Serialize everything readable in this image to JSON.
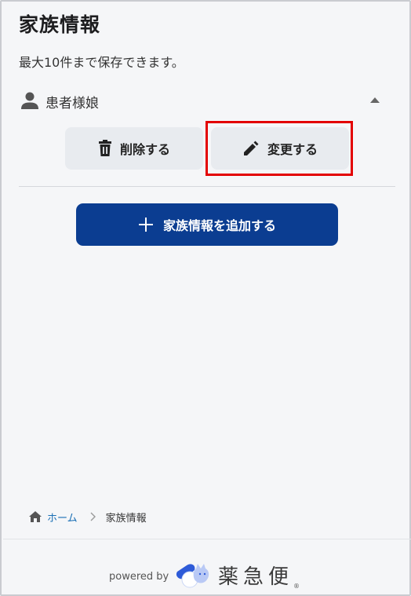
{
  "page": {
    "title": "家族情報",
    "subtitle": "最大10件まで保存できます。"
  },
  "member": {
    "name": "患者様娘",
    "icon": "person-icon",
    "toggle_icon": "caret-up-icon"
  },
  "actions": {
    "delete_label": "削除する",
    "edit_label": "変更する",
    "add_label": "家族情報を追加する"
  },
  "breadcrumb": {
    "home_label": "ホーム",
    "current_label": "家族情報"
  },
  "footer": {
    "powered_by": "powered by",
    "brand": "薬急便",
    "brand_mark": "®"
  },
  "colors": {
    "primary": "#0b3d91",
    "link": "#1a6fb5",
    "highlight": "#e30000",
    "background": "#f5f6f8",
    "button_secondary": "#e8ebef"
  }
}
